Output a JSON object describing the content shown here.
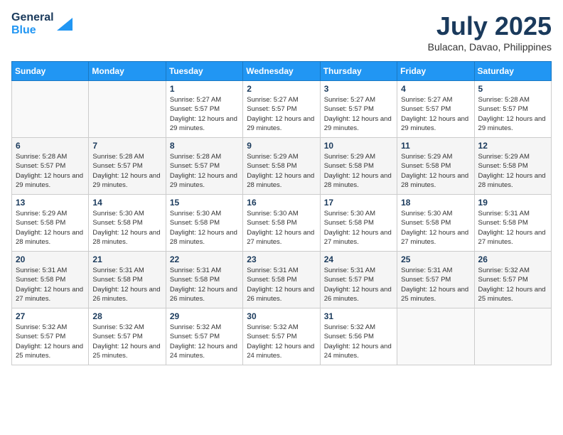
{
  "header": {
    "logo_line1": "General",
    "logo_line2": "Blue",
    "month_year": "July 2025",
    "location": "Bulacan, Davao, Philippines"
  },
  "days_of_week": [
    "Sunday",
    "Monday",
    "Tuesday",
    "Wednesday",
    "Thursday",
    "Friday",
    "Saturday"
  ],
  "weeks": [
    [
      {
        "day": "",
        "sunrise": "",
        "sunset": "",
        "daylight": ""
      },
      {
        "day": "",
        "sunrise": "",
        "sunset": "",
        "daylight": ""
      },
      {
        "day": "1",
        "sunrise": "Sunrise: 5:27 AM",
        "sunset": "Sunset: 5:57 PM",
        "daylight": "Daylight: 12 hours and 29 minutes."
      },
      {
        "day": "2",
        "sunrise": "Sunrise: 5:27 AM",
        "sunset": "Sunset: 5:57 PM",
        "daylight": "Daylight: 12 hours and 29 minutes."
      },
      {
        "day": "3",
        "sunrise": "Sunrise: 5:27 AM",
        "sunset": "Sunset: 5:57 PM",
        "daylight": "Daylight: 12 hours and 29 minutes."
      },
      {
        "day": "4",
        "sunrise": "Sunrise: 5:27 AM",
        "sunset": "Sunset: 5:57 PM",
        "daylight": "Daylight: 12 hours and 29 minutes."
      },
      {
        "day": "5",
        "sunrise": "Sunrise: 5:28 AM",
        "sunset": "Sunset: 5:57 PM",
        "daylight": "Daylight: 12 hours and 29 minutes."
      }
    ],
    [
      {
        "day": "6",
        "sunrise": "Sunrise: 5:28 AM",
        "sunset": "Sunset: 5:57 PM",
        "daylight": "Daylight: 12 hours and 29 minutes."
      },
      {
        "day": "7",
        "sunrise": "Sunrise: 5:28 AM",
        "sunset": "Sunset: 5:57 PM",
        "daylight": "Daylight: 12 hours and 29 minutes."
      },
      {
        "day": "8",
        "sunrise": "Sunrise: 5:28 AM",
        "sunset": "Sunset: 5:57 PM",
        "daylight": "Daylight: 12 hours and 29 minutes."
      },
      {
        "day": "9",
        "sunrise": "Sunrise: 5:29 AM",
        "sunset": "Sunset: 5:58 PM",
        "daylight": "Daylight: 12 hours and 28 minutes."
      },
      {
        "day": "10",
        "sunrise": "Sunrise: 5:29 AM",
        "sunset": "Sunset: 5:58 PM",
        "daylight": "Daylight: 12 hours and 28 minutes."
      },
      {
        "day": "11",
        "sunrise": "Sunrise: 5:29 AM",
        "sunset": "Sunset: 5:58 PM",
        "daylight": "Daylight: 12 hours and 28 minutes."
      },
      {
        "day": "12",
        "sunrise": "Sunrise: 5:29 AM",
        "sunset": "Sunset: 5:58 PM",
        "daylight": "Daylight: 12 hours and 28 minutes."
      }
    ],
    [
      {
        "day": "13",
        "sunrise": "Sunrise: 5:29 AM",
        "sunset": "Sunset: 5:58 PM",
        "daylight": "Daylight: 12 hours and 28 minutes."
      },
      {
        "day": "14",
        "sunrise": "Sunrise: 5:30 AM",
        "sunset": "Sunset: 5:58 PM",
        "daylight": "Daylight: 12 hours and 28 minutes."
      },
      {
        "day": "15",
        "sunrise": "Sunrise: 5:30 AM",
        "sunset": "Sunset: 5:58 PM",
        "daylight": "Daylight: 12 hours and 28 minutes."
      },
      {
        "day": "16",
        "sunrise": "Sunrise: 5:30 AM",
        "sunset": "Sunset: 5:58 PM",
        "daylight": "Daylight: 12 hours and 27 minutes."
      },
      {
        "day": "17",
        "sunrise": "Sunrise: 5:30 AM",
        "sunset": "Sunset: 5:58 PM",
        "daylight": "Daylight: 12 hours and 27 minutes."
      },
      {
        "day": "18",
        "sunrise": "Sunrise: 5:30 AM",
        "sunset": "Sunset: 5:58 PM",
        "daylight": "Daylight: 12 hours and 27 minutes."
      },
      {
        "day": "19",
        "sunrise": "Sunrise: 5:31 AM",
        "sunset": "Sunset: 5:58 PM",
        "daylight": "Daylight: 12 hours and 27 minutes."
      }
    ],
    [
      {
        "day": "20",
        "sunrise": "Sunrise: 5:31 AM",
        "sunset": "Sunset: 5:58 PM",
        "daylight": "Daylight: 12 hours and 27 minutes."
      },
      {
        "day": "21",
        "sunrise": "Sunrise: 5:31 AM",
        "sunset": "Sunset: 5:58 PM",
        "daylight": "Daylight: 12 hours and 26 minutes."
      },
      {
        "day": "22",
        "sunrise": "Sunrise: 5:31 AM",
        "sunset": "Sunset: 5:58 PM",
        "daylight": "Daylight: 12 hours and 26 minutes."
      },
      {
        "day": "23",
        "sunrise": "Sunrise: 5:31 AM",
        "sunset": "Sunset: 5:58 PM",
        "daylight": "Daylight: 12 hours and 26 minutes."
      },
      {
        "day": "24",
        "sunrise": "Sunrise: 5:31 AM",
        "sunset": "Sunset: 5:57 PM",
        "daylight": "Daylight: 12 hours and 26 minutes."
      },
      {
        "day": "25",
        "sunrise": "Sunrise: 5:31 AM",
        "sunset": "Sunset: 5:57 PM",
        "daylight": "Daylight: 12 hours and 25 minutes."
      },
      {
        "day": "26",
        "sunrise": "Sunrise: 5:32 AM",
        "sunset": "Sunset: 5:57 PM",
        "daylight": "Daylight: 12 hours and 25 minutes."
      }
    ],
    [
      {
        "day": "27",
        "sunrise": "Sunrise: 5:32 AM",
        "sunset": "Sunset: 5:57 PM",
        "daylight": "Daylight: 12 hours and 25 minutes."
      },
      {
        "day": "28",
        "sunrise": "Sunrise: 5:32 AM",
        "sunset": "Sunset: 5:57 PM",
        "daylight": "Daylight: 12 hours and 25 minutes."
      },
      {
        "day": "29",
        "sunrise": "Sunrise: 5:32 AM",
        "sunset": "Sunset: 5:57 PM",
        "daylight": "Daylight: 12 hours and 24 minutes."
      },
      {
        "day": "30",
        "sunrise": "Sunrise: 5:32 AM",
        "sunset": "Sunset: 5:57 PM",
        "daylight": "Daylight: 12 hours and 24 minutes."
      },
      {
        "day": "31",
        "sunrise": "Sunrise: 5:32 AM",
        "sunset": "Sunset: 5:56 PM",
        "daylight": "Daylight: 12 hours and 24 minutes."
      },
      {
        "day": "",
        "sunrise": "",
        "sunset": "",
        "daylight": ""
      },
      {
        "day": "",
        "sunrise": "",
        "sunset": "",
        "daylight": ""
      }
    ]
  ]
}
